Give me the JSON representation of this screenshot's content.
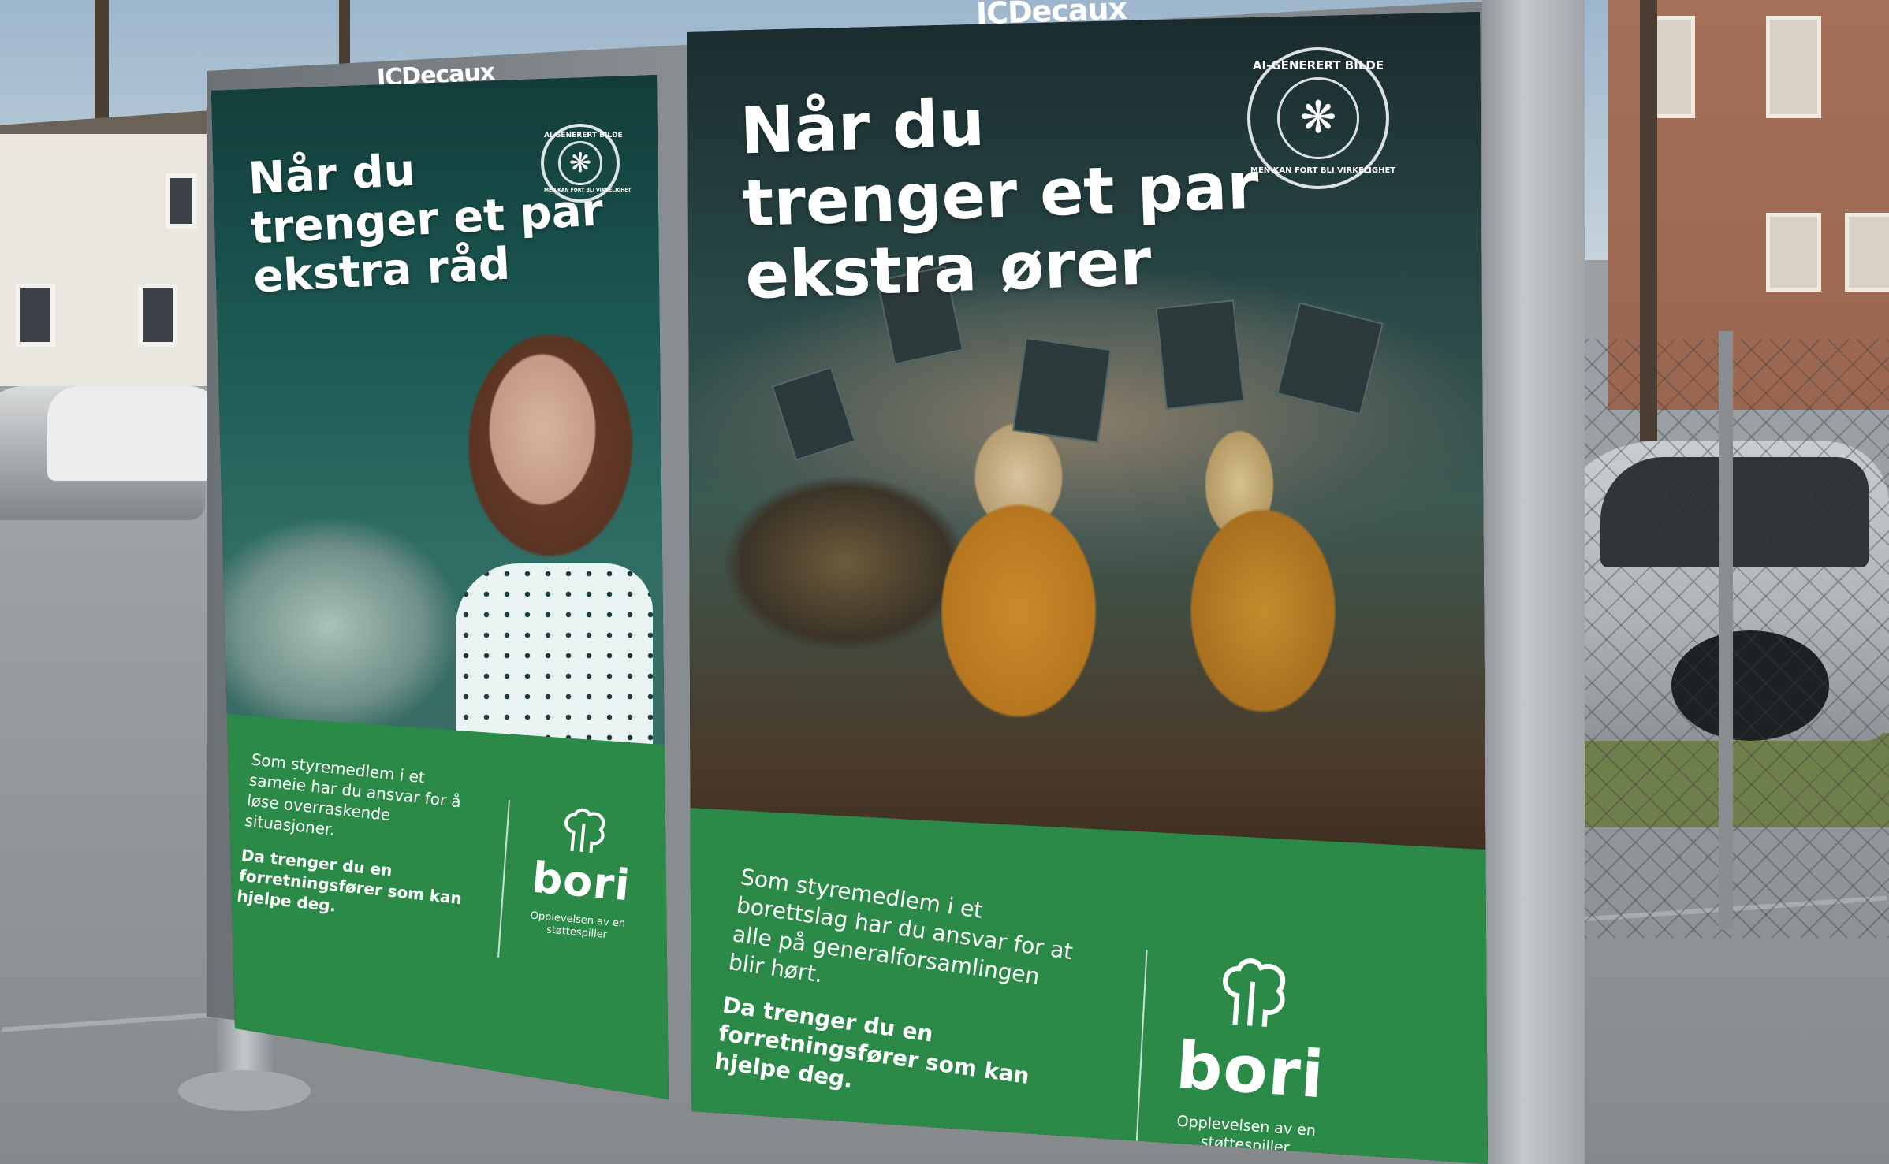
{
  "billboard": {
    "brand_left": "JCDecaux",
    "brand_right": "JCDecaux"
  },
  "poster_left": {
    "headline": [
      "Når du",
      "trenger et par",
      "ekstra råd"
    ],
    "seal_top": "AI-GENERERT BILDE",
    "seal_bottom": "MEN KAN FORT BLI VIRKELIGHET",
    "body": "Som styremedlem i et sameie har du ansvar for å løse overraskende situasjoner.",
    "body_strong": "Da trenger du en forretningsfører som kan hjelpe deg.",
    "logo_word": "bori",
    "logo_tagline": "Opplevelsen av en støttespiller"
  },
  "poster_right": {
    "headline": [
      "Når du",
      "trenger et par",
      "ekstra ører"
    ],
    "seal_top": "AI-GENERERT BILDE",
    "seal_bottom": "MEN KAN FORT BLI VIRKELIGHET",
    "body": "Som styremedlem i et borettslag har du ansvar for at alle på generalforsamlingen blir hørt.",
    "body_strong": "Da trenger du en forretningsfører som kan hjelpe deg.",
    "logo_word": "bori",
    "logo_tagline": "Opplevelsen av en støttespiller"
  },
  "icons": [
    "brain-seal-icon",
    "bori-tree-logo-icon"
  ],
  "colors": {
    "poster_green": "#2c8a49",
    "text_white": "#ffffff"
  }
}
